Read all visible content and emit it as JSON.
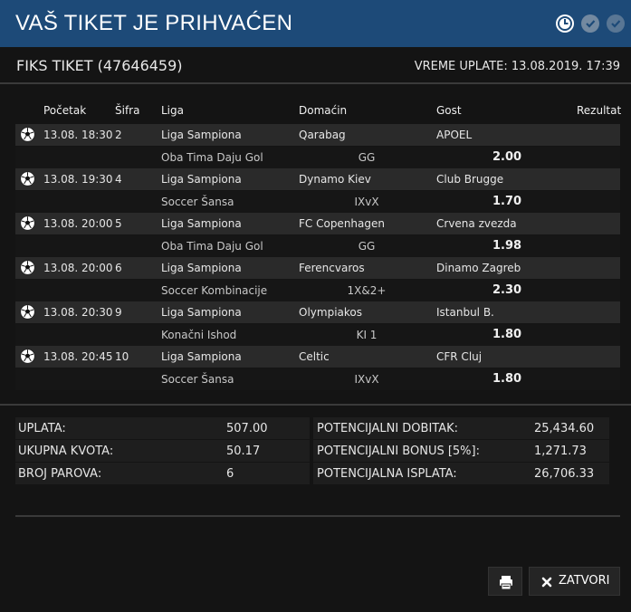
{
  "title": "VAŠ TIKET JE PRIHVAĆEN",
  "ticket": {
    "name": "FIKS TIKET (47646459)",
    "time_label": "VREME UPLATE: 13.08.2019. 17:39"
  },
  "columns": {
    "start": "Početak",
    "code": "Šifra",
    "league": "Liga",
    "home": "Domaćin",
    "away": "Gost",
    "result": "Rezultat"
  },
  "matches": [
    {
      "start": "13.08. 18:30",
      "code": "2",
      "league": "Liga Sampiona",
      "home": "Qarabag",
      "away": "APOEL",
      "bet_type": "Oba Tima Daju Gol",
      "pick": "GG",
      "odd": "2.00"
    },
    {
      "start": "13.08. 19:30",
      "code": "4",
      "league": "Liga Sampiona",
      "home": "Dynamo Kiev",
      "away": "Club Brugge",
      "bet_type": "Soccer Šansa",
      "pick": "IXvX",
      "odd": "1.70"
    },
    {
      "start": "13.08. 20:00",
      "code": "5",
      "league": "Liga Sampiona",
      "home": "FC Copenhagen",
      "away": "Crvena zvezda",
      "bet_type": "Oba Tima Daju Gol",
      "pick": "GG",
      "odd": "1.98"
    },
    {
      "start": "13.08. 20:00",
      "code": "6",
      "league": "Liga Sampiona",
      "home": "Ferencvaros",
      "away": "Dinamo Zagreb",
      "bet_type": "Soccer Kombinacije",
      "pick": "1X&2+",
      "odd": "2.30"
    },
    {
      "start": "13.08. 20:30",
      "code": "9",
      "league": "Liga Sampiona",
      "home": "Olympiakos",
      "away": "Istanbul B.",
      "bet_type": "Konačni Ishod",
      "pick": "KI 1",
      "odd": "1.80"
    },
    {
      "start": "13.08. 20:45",
      "code": "10",
      "league": "Liga Sampiona",
      "home": "Celtic",
      "away": "CFR Cluj",
      "bet_type": "Soccer Šansa",
      "pick": "IXvX",
      "odd": "1.80"
    }
  ],
  "summary_left": [
    {
      "label": "UPLATA:",
      "value": "507.00"
    },
    {
      "label": "UKUPNA KVOTA:",
      "value": "50.17"
    },
    {
      "label": "BROJ PAROVA:",
      "value": "6"
    }
  ],
  "summary_right": [
    {
      "label": "POTENCIJALNI DOBITAK:",
      "value": "25,434.60"
    },
    {
      "label": "POTENCIJALNI BONUS [5%]:",
      "value": "1,271.73"
    },
    {
      "label": "POTENCIJALNA ISPLATA:",
      "value": "26,706.33"
    }
  ],
  "buttons": {
    "close_label": "ZATVORI"
  },
  "icons": {
    "clock": "clock-icon",
    "check": "check-circle-icon",
    "ball": "soccer-ball-icon",
    "print": "print-icon",
    "close": "close-icon"
  },
  "colors": {
    "title_bar": "#1d4a78",
    "background": "#141414",
    "row_main": "#2a2a2a"
  }
}
